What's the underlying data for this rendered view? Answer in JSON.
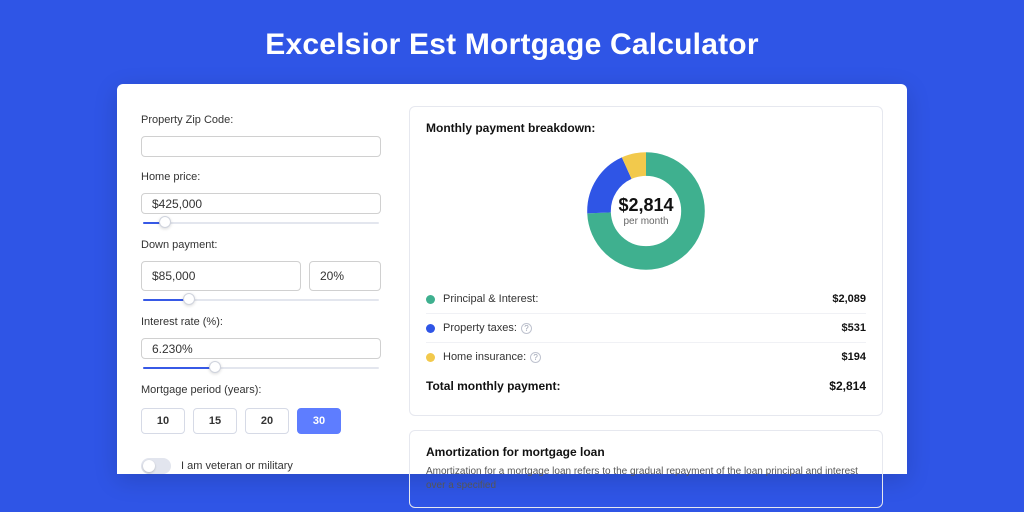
{
  "title": "Excelsior Est Mortgage Calculator",
  "form": {
    "zip_label": "Property Zip Code:",
    "zip_value": "",
    "home_price_label": "Home price:",
    "home_price_value": "$425,000",
    "home_price_slider_pct": 10,
    "down_payment_label": "Down payment:",
    "down_payment_amount": "$85,000",
    "down_payment_pct": "20%",
    "down_payment_slider_pct": 20,
    "interest_label": "Interest rate (%):",
    "interest_value": "6.230%",
    "interest_slider_pct": 31,
    "period_label": "Mortgage period (years):",
    "periods": [
      "10",
      "15",
      "20",
      "30"
    ],
    "period_selected": "30",
    "veteran_label": "I am veteran or military",
    "veteran_on": false
  },
  "breakdown": {
    "title": "Monthly payment breakdown:",
    "center_value": "$2,814",
    "center_sub": "per month",
    "items": [
      {
        "label": "Principal & Interest:",
        "value": "$2,089",
        "color": "#3fb08f",
        "has_help": false
      },
      {
        "label": "Property taxes:",
        "value": "$531",
        "color": "#2f55e6",
        "has_help": true
      },
      {
        "label": "Home insurance:",
        "value": "$194",
        "color": "#f2c94c",
        "has_help": true
      }
    ],
    "total_label": "Total monthly payment:",
    "total_value": "$2,814"
  },
  "chart_data": {
    "type": "pie",
    "title": "Monthly payment breakdown",
    "series": [
      {
        "name": "Principal & Interest",
        "value": 2089,
        "color": "#3fb08f"
      },
      {
        "name": "Property taxes",
        "value": 531,
        "color": "#2f55e6"
      },
      {
        "name": "Home insurance",
        "value": 194,
        "color": "#f2c94c"
      }
    ],
    "total": 2814
  },
  "amortization": {
    "title": "Amortization for mortgage loan",
    "text": "Amortization for a mortgage loan refers to the gradual repayment of the loan principal and interest over a specified"
  }
}
